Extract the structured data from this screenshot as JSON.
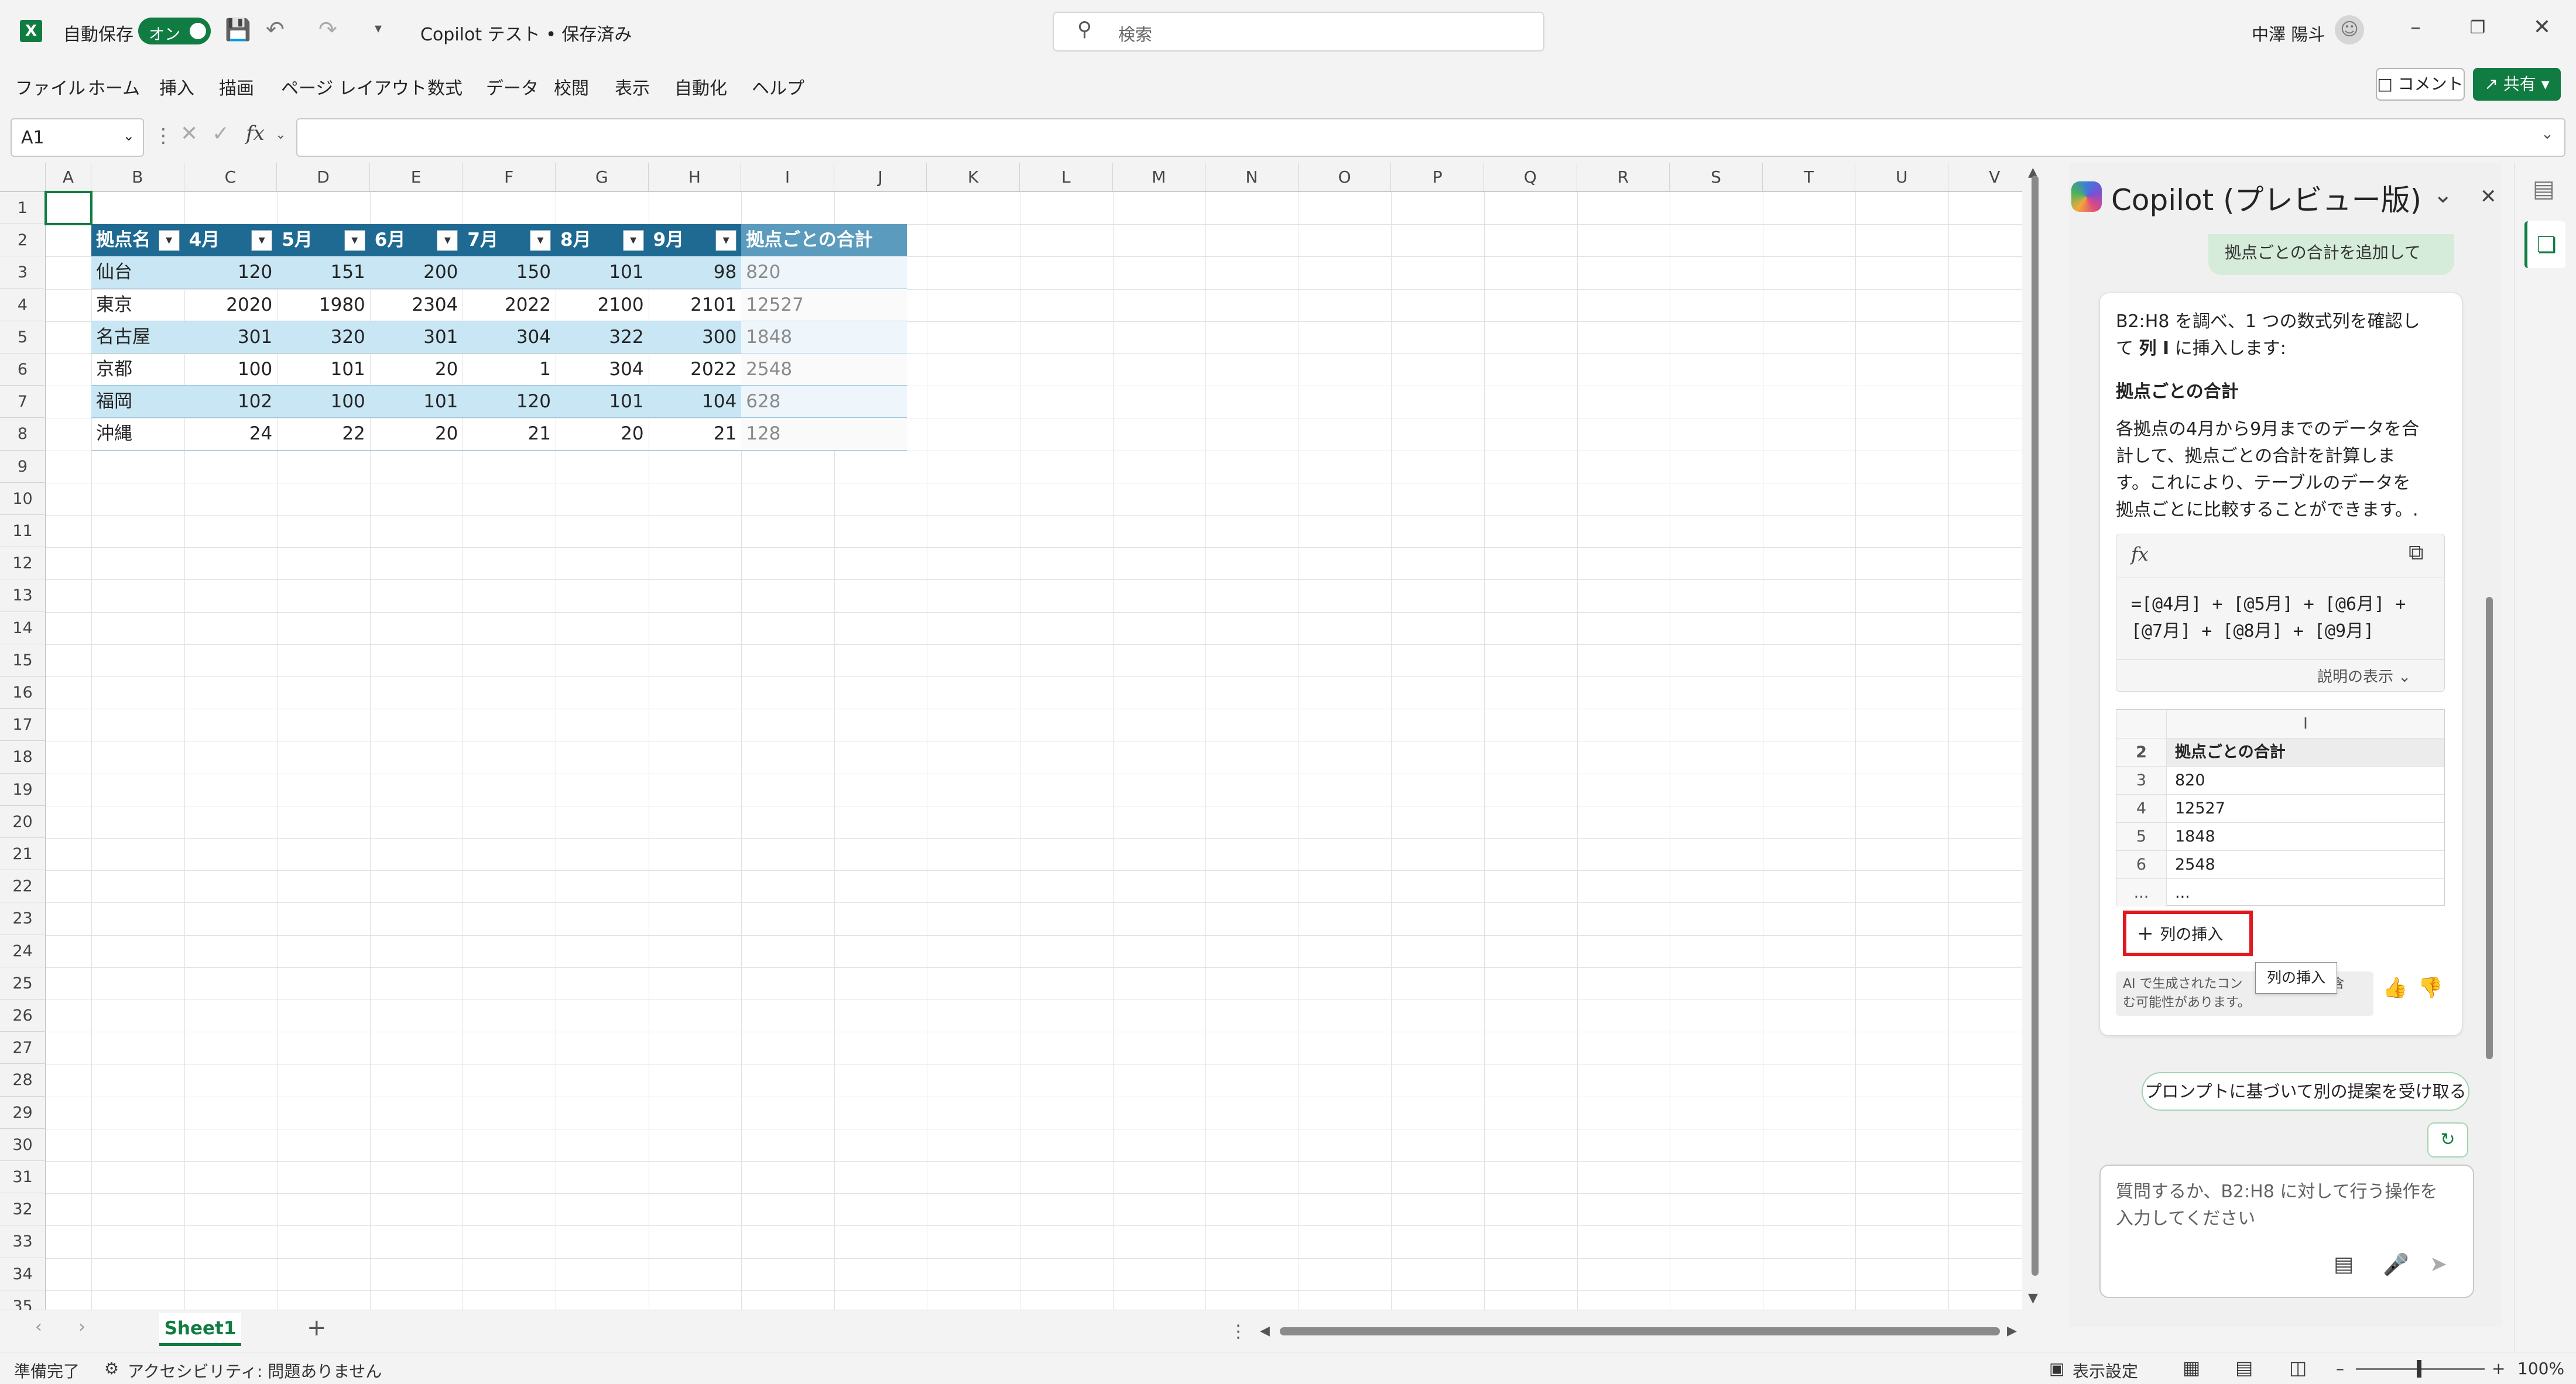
{
  "titlebar": {
    "autosave_label": "自動保存",
    "autosave_state": "オン",
    "doc_title": "Copilot テスト • 保存済み",
    "search_placeholder": "検索",
    "user_name": "中澤 陽斗"
  },
  "ribbon": {
    "tabs": [
      "ファイル",
      "ホーム",
      "挿入",
      "描画",
      "ページ レイアウト",
      "数式",
      "データ",
      "校閲",
      "表示",
      "自動化",
      "ヘルプ"
    ],
    "comment_label": "コメント",
    "share_label": "共有"
  },
  "formula_bar": {
    "name_box": "A1",
    "fx": "fx",
    "formula_value": ""
  },
  "grid": {
    "columns": [
      "A",
      "B",
      "C",
      "D",
      "E",
      "F",
      "G",
      "H",
      "I",
      "J",
      "K",
      "L",
      "M",
      "N",
      "O",
      "P",
      "Q",
      "R",
      "S",
      "T",
      "U",
      "V"
    ],
    "rows": [
      "1",
      "2",
      "3",
      "4",
      "5",
      "6",
      "7",
      "8",
      "9",
      "10",
      "11",
      "12",
      "13",
      "14",
      "15",
      "16",
      "17",
      "18",
      "19",
      "20",
      "21",
      "22",
      "23",
      "24",
      "25",
      "26",
      "27",
      "28",
      "29",
      "30",
      "31",
      "32",
      "33",
      "34",
      "35"
    ],
    "table_headers": [
      "拠点名",
      "4月",
      "5月",
      "6月",
      "7月",
      "8月",
      "9月",
      "拠点ごとの合計"
    ],
    "table_rows": [
      [
        "仙台",
        "120",
        "151",
        "200",
        "150",
        "101",
        "98",
        "820"
      ],
      [
        "東京",
        "2020",
        "1980",
        "2304",
        "2022",
        "2100",
        "2101",
        "12527"
      ],
      [
        "名古屋",
        "301",
        "320",
        "301",
        "304",
        "322",
        "300",
        "1848"
      ],
      [
        "京都",
        "100",
        "101",
        "20",
        "1",
        "304",
        "2022",
        "2548"
      ],
      [
        "福岡",
        "102",
        "100",
        "101",
        "120",
        "101",
        "104",
        "628"
      ],
      [
        "沖縄",
        "24",
        "22",
        "20",
        "21",
        "20",
        "21",
        "128"
      ]
    ],
    "colors": {
      "header": "#1e6a93",
      "header_preview": "#5b9bbd",
      "band": "#c9e6f4",
      "selection": "#107c41"
    }
  },
  "sheets": {
    "active": "Sheet1"
  },
  "status": {
    "ready": "準備完了",
    "accessibility": "アクセシビリティ: 問題ありません",
    "display_settings": "表示設定",
    "zoom": "100%"
  },
  "copilot": {
    "title": "Copilot (プレビュー版)",
    "prev_message": "拠点ごとの合計を追加して",
    "intro_line1": "B2:H8 を調べ、1 つの数式列を確認し",
    "intro_line2_pre": "て ",
    "intro_line2_bold": "列 I",
    "intro_line2_post": " に挿入します:",
    "section_title": "拠点ごとの合計",
    "description": [
      "各拠点の4月から9月までのデータを合",
      "計して、拠点ごとの合計を計算しま",
      "す。これにより、テーブルのデータを",
      "拠点ごとに比較することができます。."
    ],
    "formula_lines": [
      "=[@4月] + [@5月] + [@6月] +",
      "[@7月] + [@8月] + [@9月]"
    ],
    "show_explanation": "説明の表示",
    "preview": {
      "column_letter": "I",
      "rows": [
        {
          "num": "2",
          "value": "拠点ごとの合計"
        },
        {
          "num": "3",
          "value": "820"
        },
        {
          "num": "4",
          "value": "12527"
        },
        {
          "num": "5",
          "value": "1848"
        },
        {
          "num": "6",
          "value": "2548"
        },
        {
          "num": "...",
          "value": "..."
        }
      ]
    },
    "insert_column_label": "列の挿入",
    "tooltip": "列の挿入",
    "ai_note_line1": "AI で生成されたコン",
    "ai_note_line1_tail": "を含",
    "ai_note_line2": "む可能性があります。",
    "alt_suggestion": "プロンプトに基づいて別の提案を受け取る",
    "input_placeholder_line1": "質問するか、B2:H8 に対して行う操作を",
    "input_placeholder_line2": "入力してください"
  },
  "icons": [
    "excel-logo-icon",
    "save-icon",
    "undo-icon",
    "redo-icon",
    "search-icon",
    "user-icon",
    "minimize-icon",
    "restore-icon",
    "close-icon",
    "copy-icon",
    "plus-icon",
    "thumbs-up-icon",
    "thumbs-down-icon",
    "refresh-icon",
    "notebook-icon",
    "mic-icon",
    "send-icon"
  ]
}
